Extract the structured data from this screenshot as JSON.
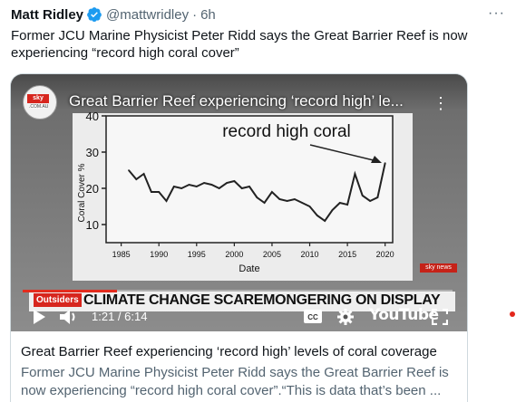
{
  "tweet": {
    "name": "Matt Ridley",
    "handle": "@mattwridley",
    "separator": "·",
    "time": "6h",
    "more": "···",
    "text": "Former JCU Marine Physicist Peter Ridd says the Great Barrier Reef is now experiencing “record high coral cover”"
  },
  "video": {
    "title": "Great Barrier Reef experiencing ‘record high’ le...",
    "logo": {
      "brand": "sky news",
      "sub": ".COM.AU"
    },
    "chart_caption": "record high coral",
    "watermark": "sky news",
    "banner_tag": "Outsiders",
    "banner_text": "CLIMATE CHANGE SCAREMONGERING ON DISPLAY",
    "time": "1:21 / 6:14",
    "progress": 0.219,
    "youtube_label": "YouTube",
    "icons": [
      "play-icon",
      "volume-icon",
      "cc-icon",
      "gear-icon",
      "fullscreen-icon"
    ]
  },
  "chart_data": {
    "type": "line",
    "title": "record high coral",
    "xlabel": "Date",
    "ylabel": "Coral Cover %",
    "xlim": [
      1983,
      2021
    ],
    "ylim": [
      5,
      40
    ],
    "xticks": [
      1985,
      1990,
      1995,
      2000,
      2005,
      2010,
      2015,
      2020
    ],
    "yticks": [
      10,
      20,
      30,
      40
    ],
    "x": [
      1986,
      1987,
      1988,
      1989,
      1990,
      1991,
      1992,
      1993,
      1994,
      1995,
      1996,
      1997,
      1998,
      1999,
      2000,
      2001,
      2002,
      2003,
      2004,
      2005,
      2006,
      2007,
      2008,
      2009,
      2010,
      2011,
      2012,
      2013,
      2014,
      2015,
      2016,
      2017,
      2018,
      2019,
      2020
    ],
    "values": [
      25,
      22.5,
      24,
      19,
      19,
      16.5,
      20.5,
      20,
      21,
      20.5,
      21.5,
      21,
      20,
      21.5,
      22,
      20,
      20.5,
      17.5,
      16,
      19,
      17,
      16.5,
      17,
      16,
      15,
      12.5,
      11,
      14,
      16,
      15.5,
      24,
      18,
      16.5,
      17.5,
      27
    ],
    "annotation": "arrow pointing to 2020 peak",
    "line_color": "#222222"
  },
  "card": {
    "title": "Great Barrier Reef experiencing ‘record high’ levels of coral coverage",
    "description": "Former JCU Marine Physicist Peter Ridd says the Great Barrier Reef is now experiencing “record high coral cover”.“This is data that’s been ..."
  },
  "colors": {
    "accent": "#1d9bf0",
    "brand_red": "#d7261e"
  }
}
